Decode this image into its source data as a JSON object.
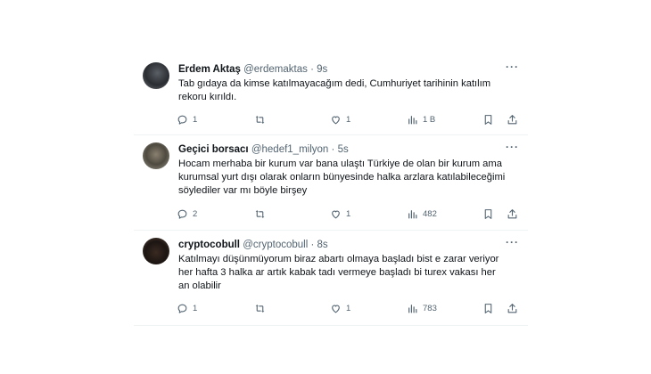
{
  "tweets": [
    {
      "name": "Erdem Aktaş",
      "handle": "@erdemaktas",
      "dot": "·",
      "time": "9s",
      "text": "Tab gıdaya da kimse katılmayacağım dedi, Cumhuriyet tarihinin katılım rekoru kırıldı.",
      "replies": "1",
      "likes": "1",
      "views": "1 B"
    },
    {
      "name": "Geçici borsacı",
      "handle": "@hedef1_milyon",
      "dot": "·",
      "time": "5s",
      "text": "Hocam merhaba  bir kurum var bana ulaştı Türkiye de olan bir kurum ama kurumsal yurt dışı olarak onların bünyesinde halka arzlara katılabileceğimi söylediler var mı böyle birşey",
      "replies": "2",
      "likes": "1",
      "views": "482"
    },
    {
      "name": "cryptocobull",
      "handle": "@cryptocobull",
      "dot": "·",
      "time": "8s",
      "text": "Katılmayı düşünmüyorum biraz abartı olmaya başladı bist e  zarar veriyor her hafta 3 halka ar artık kabak tadı vermeye başladı bi turex vakası her an olabilir",
      "replies": "1",
      "likes": "1",
      "views": "783"
    }
  ],
  "icons": {
    "more": "more-options-icon",
    "reply": "reply-icon",
    "retweet": "retweet-icon",
    "like": "like-icon",
    "views": "views-icon",
    "bookmark": "bookmark-icon",
    "share": "share-icon"
  },
  "colors": {
    "text": "#0f1419",
    "secondary": "#536471",
    "divider": "#eff3f4"
  }
}
